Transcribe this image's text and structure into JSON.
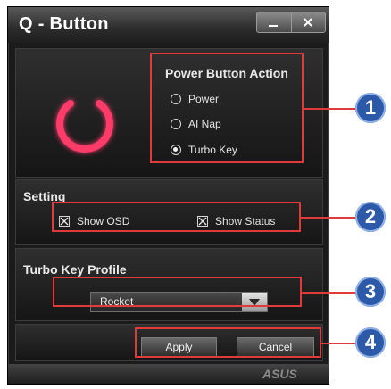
{
  "window": {
    "title": "Q - Button",
    "minimize_icon": "minimize-icon",
    "close_icon": "close-icon"
  },
  "power_action": {
    "icon": "power-icon",
    "title": "Power Button Action",
    "options": [
      "Power",
      "AI Nap",
      "Turbo Key"
    ],
    "selected": "Turbo Key"
  },
  "setting": {
    "title": "Setting",
    "show_osd": "Show OSD",
    "show_status": "Show Status",
    "show_osd_checked": true,
    "show_status_checked": true
  },
  "turbo": {
    "title": "Turbo Key Profile",
    "selected_profile": "Rocket"
  },
  "buttons": {
    "apply": "Apply",
    "cancel": "Cancel"
  },
  "footer": {
    "logo": "ASUS"
  },
  "callouts": [
    "1",
    "2",
    "3",
    "4"
  ],
  "colors": {
    "highlight": "#e03a3a",
    "callout": "#2c5aa8",
    "power_glow": "#ff3b6b"
  }
}
